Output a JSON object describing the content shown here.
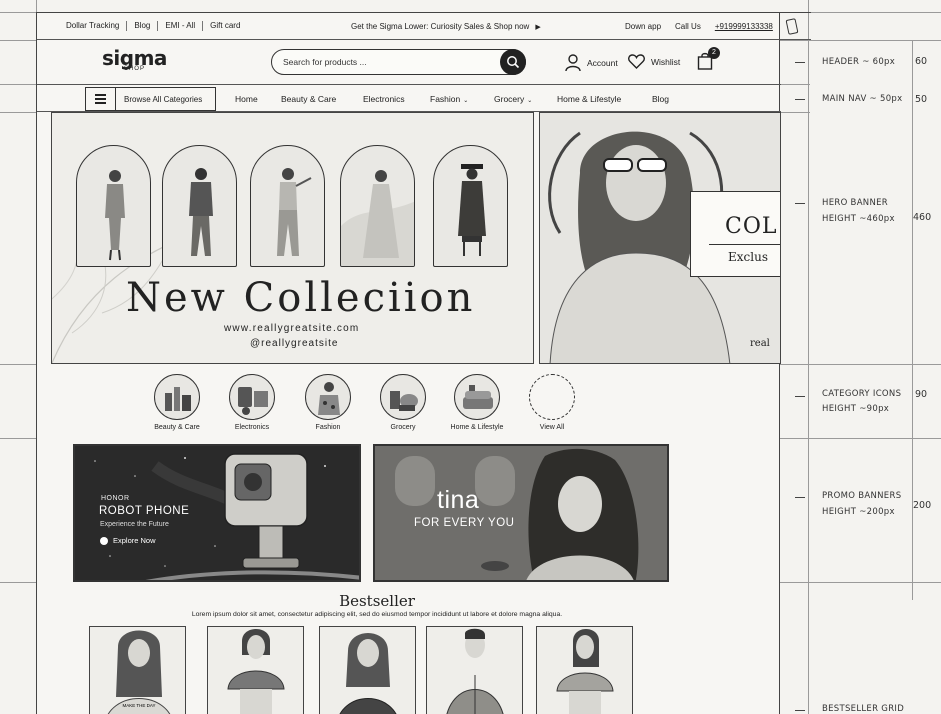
{
  "topbar": {
    "links": [
      "Dollar Tracking",
      "Blog",
      "EMI - All",
      "Gift card"
    ],
    "promo": "Get the Sigma Lower: Curiosity Sales & Shop now",
    "promo_arrow": "▶",
    "download": "Down app",
    "call": "Call Us",
    "phone": "+919999133338"
  },
  "header": {
    "logo_main": "sigma",
    "logo_sub": "SHOP",
    "search_placeholder": "Search for products ...",
    "account_label": "Account",
    "wishlist_label": "Wishlist",
    "cart_count": "2"
  },
  "nav": {
    "browse_label": "Browse All Categories",
    "items": [
      {
        "label": "Home",
        "caret": ""
      },
      {
        "label": "Beauty & Care",
        "caret": ""
      },
      {
        "label": "Electronics",
        "caret": ""
      },
      {
        "label": "Fashion",
        "caret": "⌄"
      },
      {
        "label": "Grocery",
        "caret": "⌄"
      },
      {
        "label": "Home & Lifestyle",
        "caret": ""
      },
      {
        "label": "Blog",
        "caret": ""
      }
    ]
  },
  "hero": {
    "title": "New Colleciion",
    "url": "www.reallygreatsite.com",
    "handle": "@reallygreatsite",
    "side_title": "COL",
    "side_sub": "Exclus",
    "side_corner": "real"
  },
  "categories": [
    {
      "label": "Beauty & Care"
    },
    {
      "label": "Electronics"
    },
    {
      "label": "Fashion"
    },
    {
      "label": "Grocery"
    },
    {
      "label": "Home & Lifestyle"
    },
    {
      "label": "View All"
    }
  ],
  "promos": {
    "p1_brand": "HONOR",
    "p1_name": "ROBOT PHONE",
    "p1_tag": "Experience the Future",
    "p1_cta": "Explore Now",
    "p2_title": "tina",
    "p2_sub": "FOR EVERY YOU"
  },
  "bestseller": {
    "title": "Bestseller",
    "subtitle": "Lorem ipsum dolor sit amet, consectetur adipiscing elit, sed do eiusmod tempor incididunt ut labore et dolore magna aliqua.",
    "shirt_text": "MAKE THE DAY"
  },
  "annotations": {
    "header": "HEADER ~ 60px",
    "header_num": "60",
    "nav": "MAIN NAV ~ 50px",
    "nav_num": "50",
    "hero_1": "HERO BANNER",
    "hero_2": "HEIGHT ~460px",
    "hero_num": "460",
    "cat_1": "CATEGORY ICONS",
    "cat_2": "HEIGHT ~90px",
    "cat_num": "90",
    "promo_1": "PROMO BANNERS",
    "promo_2": "HEIGHT ~200px",
    "promo_num": "200",
    "best": "BESTSELLER GRID"
  }
}
